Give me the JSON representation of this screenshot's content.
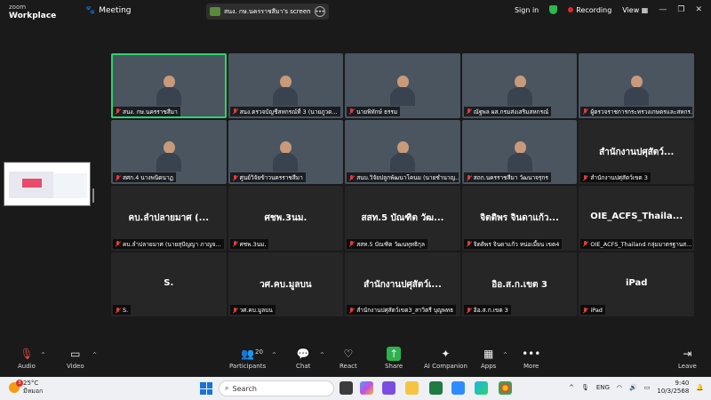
{
  "app": {
    "logo_line1": "zoom",
    "logo_line2": "Workplace",
    "meeting_label": "Meeting",
    "share_label": "สนง. กษ.นครราชสีมา's screen",
    "sign_in": "Sign in",
    "recording": "Recording",
    "view": "View"
  },
  "tiles": [
    {
      "name": "สนง. กษ.นครราชสีมา",
      "video": true,
      "active": true,
      "bg": "v1"
    },
    {
      "name": "สนง.ตรวจบัญชีสหกรณ์ที่ 3 (นายภูวด...",
      "video": true,
      "bg": "v2"
    },
    {
      "name": "นายพิทักษ์ ธรรม",
      "video": true,
      "bg": "v3"
    },
    {
      "name": "ณัฐพล ผส.กรมส่งเสริมสหกรณ์",
      "video": true,
      "bg": "v4"
    },
    {
      "name": "ผู้ตรวจราชการกระทรวงเกษตรและสหกร...",
      "video": true,
      "bg": "v5"
    },
    {
      "name": "สศก.4 นางพนิดนาฏ",
      "video": true,
      "bg": "v6"
    },
    {
      "name": "ศูนย์วิจัยข้าวนครราชสีมา",
      "video": true,
      "bg": "v7"
    },
    {
      "name": "สนบ.วิจัยปลูกพัฒนาโคนม (นายชำนาญ...",
      "video": true,
      "bg": "v8"
    },
    {
      "name": "สถก.นครราชสีมา วัฒนาจรุกร",
      "video": true,
      "bg": "v9"
    },
    {
      "name": "สำนักงานปศุสัตว์เขต 3",
      "big": "สำนักงานปศุสัตว์...",
      "video": false
    },
    {
      "name": "คบ.ลำปลายมาศ (นายสุปัญญา ภาญจ...",
      "big": "คบ.ลำปลายมาศ (...",
      "video": false
    },
    {
      "name": "ศชพ.3นม.",
      "big": "ศชพ.3นม.",
      "video": false
    },
    {
      "name": "สสท.5 บัณฑิต วัฒนทุทธิกุล",
      "big": "สสท.5 บัณฑิต วัฒ...",
      "video": false
    },
    {
      "name": "จิตติพร จินดาแก้ว หน่อเมี้ยน เขต4",
      "big": "จิตติพร จินดาแก้ว...",
      "video": false
    },
    {
      "name": "OIE_ACFS_Thailand กลุ่มมาตรฐานส...",
      "big": "OIE_ACFS_Thaila...",
      "video": false
    },
    {
      "name": "S.",
      "big": "S.",
      "video": false
    },
    {
      "name": "วศ.คบ.มูลบน",
      "big": "วศ.คบ.มูลบน",
      "video": false
    },
    {
      "name": "สำนักงานปศุสัตว์เขต3_สาวิตรี บุญพทธ",
      "big": "สำนักงานปศุสัตว์เ...",
      "video": false
    },
    {
      "name": "อิอ.ส.ก.เขต 3",
      "big": "อิอ.ส.ก.เขต 3",
      "video": false
    },
    {
      "name": "iPad",
      "big": "iPad",
      "video": false
    }
  ],
  "toolbar": {
    "audio": "Audio",
    "video": "Video",
    "participants": "Participants",
    "participants_count": "20",
    "chat": "Chat",
    "react": "React",
    "share": "Share",
    "ai_companion": "AI Companion",
    "apps": "Apps",
    "more": "More",
    "leave": "Leave"
  },
  "taskbar": {
    "temperature": "25°C",
    "weather_text": "มีหมอก",
    "weather_badge": "3",
    "search_placeholder": "Search",
    "lang": "ENG",
    "time": "9:40",
    "date": "10/3/2568"
  },
  "colors": {
    "active_outline": "#2bd46c",
    "recording": "#e02828",
    "share_button": "#2bb24c",
    "leave": "#e24646"
  }
}
